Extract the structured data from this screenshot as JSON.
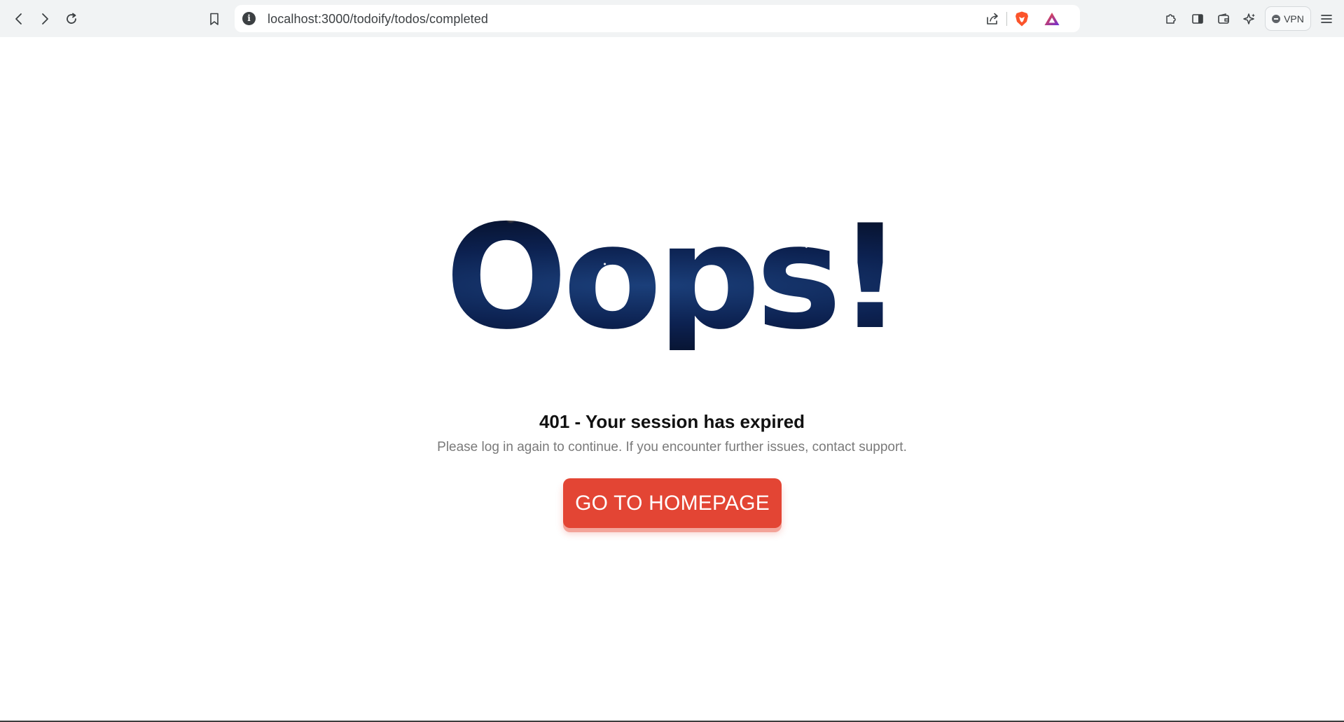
{
  "browser": {
    "url": "localhost:3000/todoify/todos/completed",
    "info_icon_glyph": "i",
    "vpn_label": "VPN",
    "icons": [
      "back-icon",
      "forward-icon",
      "reload-icon",
      "bookmark-icon",
      "site-info-icon",
      "share-icon",
      "brave-shields-icon",
      "brave-rewards-icon",
      "extensions-icon",
      "sidebar-icon",
      "wallet-icon",
      "leo-ai-icon",
      "vpn-icon",
      "menu-icon"
    ],
    "colors": {
      "toolbar": "#f1f3f4",
      "brave_orange": "#fb542b",
      "rewards_purple": "#6a2fd8"
    }
  },
  "error_page": {
    "title": "Oops!",
    "heading": "401 - Your session has expired",
    "message": "Please log in again to continue. If you encounter further issues, contact support.",
    "button_label": "GO TO HOMEPAGE",
    "colors": {
      "button": "#e34534",
      "button_shadow": "#f3a49a",
      "text": "#111111",
      "muted": "#7a7a7a"
    }
  }
}
